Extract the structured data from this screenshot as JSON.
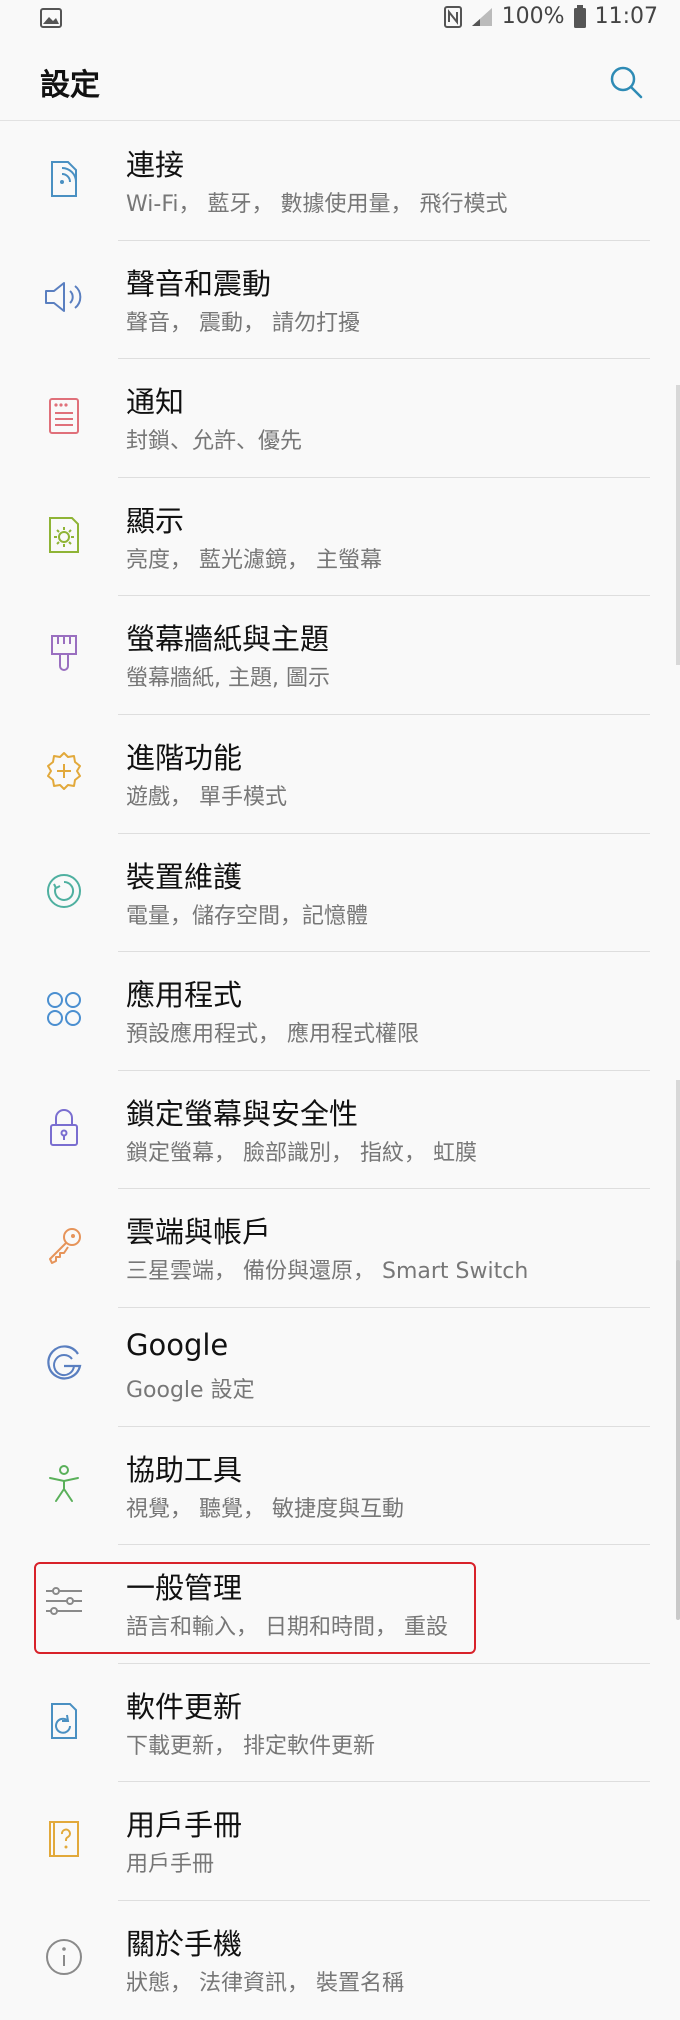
{
  "status_bar": {
    "battery": "100%",
    "time": "11:07"
  },
  "app_bar": {
    "title": "設定"
  },
  "items": [
    {
      "title": "連接",
      "subtitle": "Wi-Fi， 藍牙， 數據使用量， 飛行模式",
      "icon": "connections-icon",
      "color": "#4a90c2"
    },
    {
      "title": "聲音和震動",
      "subtitle": "聲音， 震動， 請勿打擾",
      "icon": "speaker-icon",
      "color": "#5a7fc0"
    },
    {
      "title": "通知",
      "subtitle": "封鎖、允許、優先",
      "icon": "notification-icon",
      "color": "#e0707a"
    },
    {
      "title": "顯示",
      "subtitle": "亮度， 藍光濾鏡， 主螢幕",
      "icon": "display-icon",
      "color": "#8fb436"
    },
    {
      "title": "螢幕牆紙與主題",
      "subtitle": "螢幕牆紙, 主題, 圖示",
      "icon": "brush-icon",
      "color": "#9a6fc0"
    },
    {
      "title": "進階功能",
      "subtitle": "遊戲， 單手模式",
      "icon": "gear-plus-icon",
      "color": "#e2a93b"
    },
    {
      "title": "裝置維護",
      "subtitle": "電量，儲存空間，記憶體",
      "icon": "device-care-icon",
      "color": "#4fb0a0"
    },
    {
      "title": "應用程式",
      "subtitle": "預設應用程式， 應用程式權限",
      "icon": "apps-icon",
      "color": "#4b8fd0"
    },
    {
      "title": "鎖定螢幕與安全性",
      "subtitle": "鎖定螢幕， 臉部識別， 指紋， 虹膜",
      "icon": "lock-icon",
      "color": "#7a6ed0"
    },
    {
      "title": "雲端與帳戶",
      "subtitle": "三星雲端， 備份與還原， Smart Switch",
      "icon": "key-icon",
      "color": "#e6945a"
    },
    {
      "title": "Google",
      "subtitle": "Google 設定",
      "icon": "google-icon",
      "color": "#5a7fc0"
    },
    {
      "title": "協助工具",
      "subtitle": "視覺， 聽覺， 敏捷度與互動",
      "icon": "accessibility-icon",
      "color": "#5ab05a"
    },
    {
      "title": "一般管理",
      "subtitle": "語言和輸入， 日期和時間， 重設",
      "icon": "sliders-icon",
      "color": "#8a8a8a"
    },
    {
      "title": "軟件更新",
      "subtitle": "下載更新， 排定軟件更新",
      "icon": "update-icon",
      "color": "#4a90c2"
    },
    {
      "title": "用戶手冊",
      "subtitle": "用戶手冊",
      "icon": "manual-icon",
      "color": "#e2a93b"
    },
    {
      "title": "關於手機",
      "subtitle": "狀態， 法律資訊， 裝置名稱",
      "icon": "info-icon",
      "color": "#8a8a8a"
    }
  ]
}
